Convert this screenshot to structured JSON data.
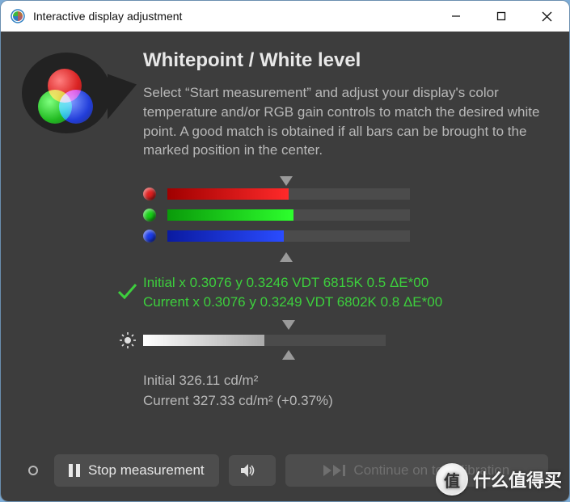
{
  "window": {
    "title": "Interactive display adjustment"
  },
  "heading": "Whitepoint / White level",
  "description": "Select “Start measurement” and adjust your display's color temperature and/or RGB gain controls to match the desired white point. A good match is obtained if all bars can be brought to the marked position in the center.",
  "rgb": {
    "r": {
      "color": "#e02020",
      "grad_start": "#a00000",
      "grad_end": "#ff2a2a",
      "fill_pct": 50
    },
    "g": {
      "color": "#16d016",
      "grad_start": "#0a9a0a",
      "grad_end": "#2dff2d",
      "fill_pct": 52
    },
    "b": {
      "color": "#1a3ae8",
      "grad_start": "#0a1aa0",
      "grad_end": "#2a4cff",
      "fill_pct": 48
    }
  },
  "status": {
    "initial": "Initial x 0.3076 y 0.3246 VDT 6815K 0.5 ΔE*00",
    "current": "Current x 0.3076 y 0.3249 VDT 6802K 0.8 ΔE*00"
  },
  "brightness": {
    "fill_pct": 50,
    "initial": "Initial 326.11 cd/m²",
    "current": "Current 327.33 cd/m² (+0.37%)"
  },
  "buttons": {
    "stop": "Stop measurement",
    "continue": "Continue on to calibration"
  },
  "watermark": {
    "symbol": "值",
    "text": "什么值得买"
  }
}
